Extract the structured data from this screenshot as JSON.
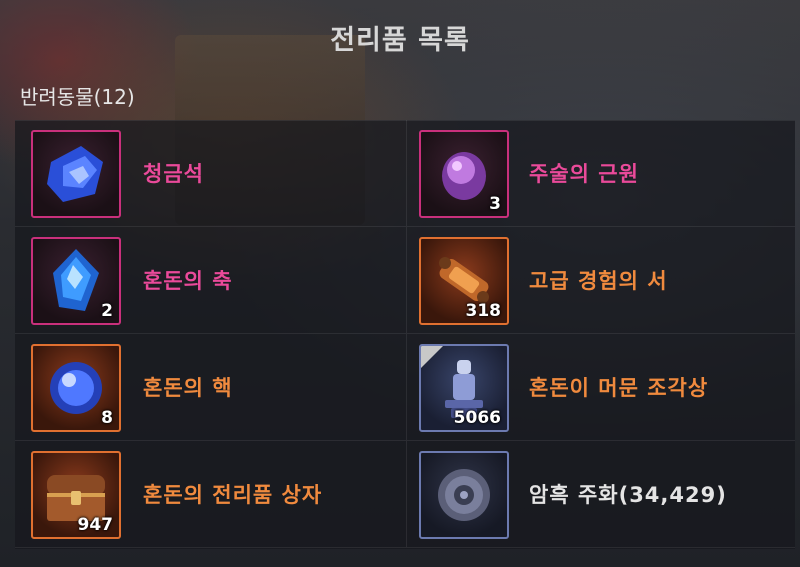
{
  "window": {
    "title": "전리품 목록"
  },
  "section": {
    "label": "반려동물(12)"
  },
  "items": [
    {
      "name": "청금석",
      "count": "",
      "grade": "pink",
      "icon": "lapis-crystal-icon"
    },
    {
      "name": "주술의 근원",
      "count": "3",
      "grade": "pink",
      "icon": "sorcery-source-icon"
    },
    {
      "name": "혼돈의 축",
      "count": "2",
      "grade": "pink",
      "icon": "chaos-axis-gem-icon"
    },
    {
      "name": "고급 경험의 서",
      "count": "318",
      "grade": "orange",
      "icon": "scroll-icon"
    },
    {
      "name": "혼돈의 핵",
      "count": "8",
      "grade": "orange",
      "icon": "chaos-core-orb-icon"
    },
    {
      "name": "혼돈이 머문 조각상",
      "count": "5066",
      "grade": "blue",
      "icon": "statue-icon"
    },
    {
      "name": "혼돈의 전리품 상자",
      "count": "947",
      "grade": "orange",
      "icon": "treasure-chest-icon"
    },
    {
      "name": "암흑 주화",
      "amount": "(34,429)",
      "grade": "purple",
      "icon": "dark-coin-icon"
    }
  ],
  "colors": {
    "pink": "#ea4a9a",
    "orange": "#f08a3e",
    "text": "#e4e4e4"
  }
}
